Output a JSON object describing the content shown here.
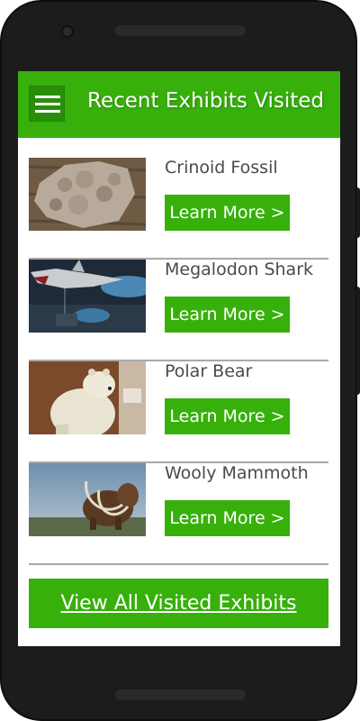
{
  "app_bar": {
    "title": "Recent Exhibits Visited",
    "menu_icon": "hamburger-menu-icon",
    "color": "#37b00b"
  },
  "exhibits": [
    {
      "name": "Crinoid Fossil",
      "button_label": "Learn More >"
    },
    {
      "name": "Megalodon Shark",
      "button_label": "Learn More >"
    },
    {
      "name": "Polar Bear",
      "button_label": "Learn More >"
    },
    {
      "name": "Wooly Mammoth",
      "button_label": "Learn More >"
    }
  ],
  "footer": {
    "view_all_label": "View All Visited Exhibits"
  },
  "colors": {
    "accent": "#37b00b",
    "text": "#4a4a4a",
    "divider": "#a9a9a9"
  }
}
